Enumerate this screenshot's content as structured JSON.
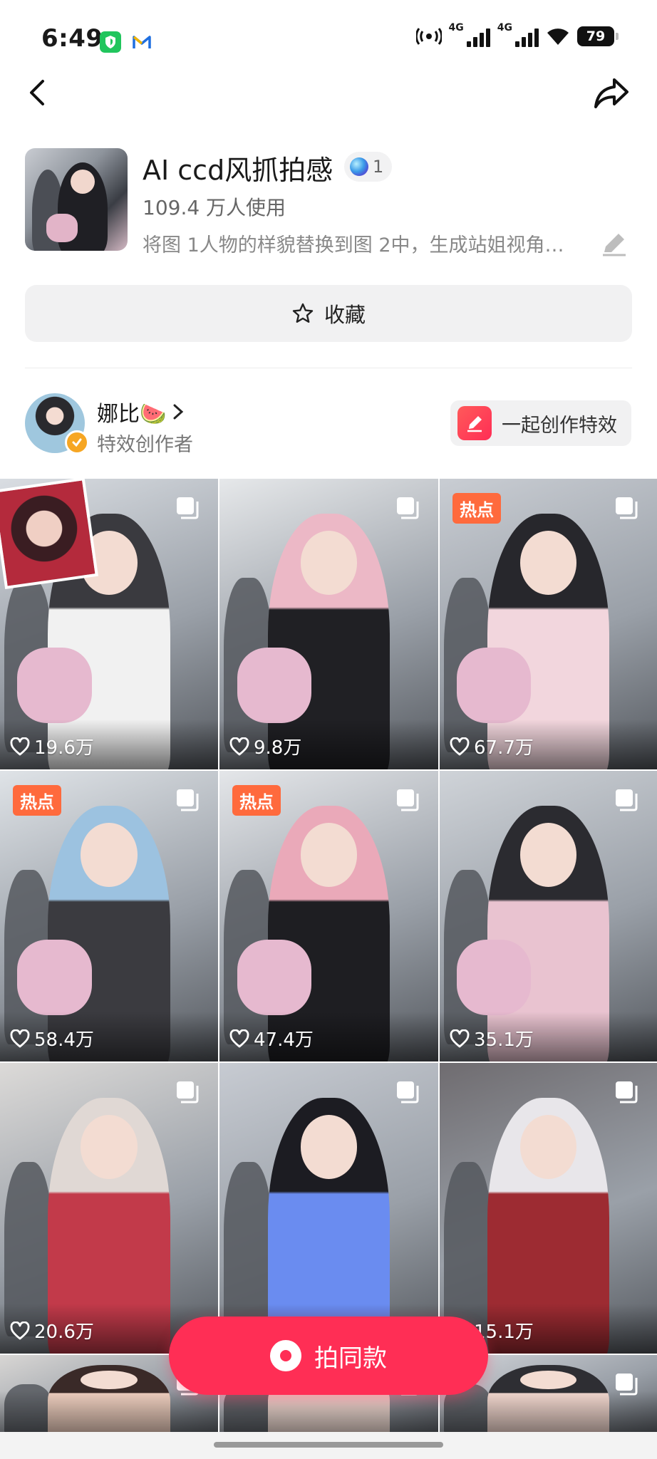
{
  "status_bar": {
    "time": "6:49",
    "network_1": "4G",
    "network_2": "4G",
    "battery": "79"
  },
  "effect": {
    "title": "AI ccd风抓拍感",
    "badge_count": "1",
    "usage": "109.4 万人使用",
    "description": "将图 1人物的样貌替换到图 2中，生成站姐视角…",
    "favorite_label": "收藏"
  },
  "creator": {
    "name": "娜比🍉",
    "role": "特效创作者",
    "co_create_label": "一起创作特效"
  },
  "grid": {
    "tiles": [
      {
        "likes": "19.6万",
        "hot": ""
      },
      {
        "likes": "9.8万",
        "hot": ""
      },
      {
        "likes": "67.7万",
        "hot": "热点"
      },
      {
        "likes": "58.4万",
        "hot": "热点"
      },
      {
        "likes": "47.4万",
        "hot": "热点"
      },
      {
        "likes": "35.1万",
        "hot": ""
      },
      {
        "likes": "20.6万",
        "hot": ""
      },
      {
        "likes": "",
        "hot": ""
      },
      {
        "likes": "15.1万",
        "hot": ""
      },
      {
        "likes": "",
        "hot": ""
      },
      {
        "likes": "",
        "hot": ""
      },
      {
        "likes": "",
        "hot": ""
      }
    ]
  },
  "action": {
    "shoot_same_label": "拍同款"
  },
  "colors": {
    "accent": "#ff2e55",
    "hot_badge": "#ff6a3d"
  }
}
